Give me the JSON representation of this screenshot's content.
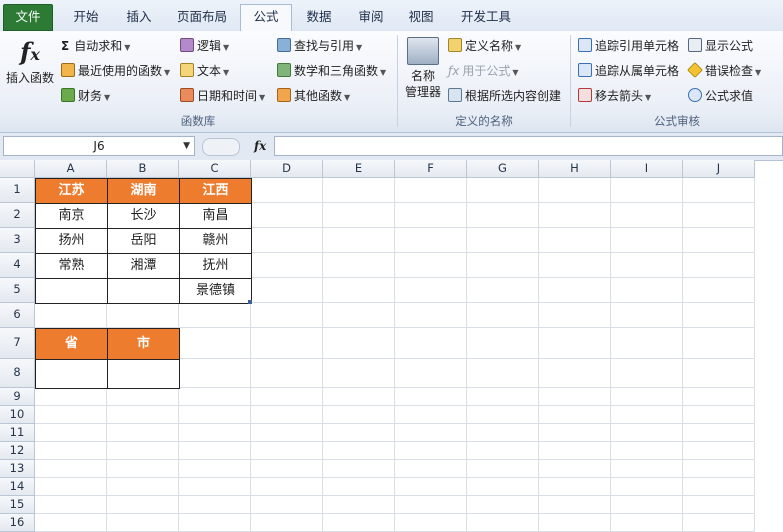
{
  "tabs": [
    "文件",
    "开始",
    "插入",
    "页面布局",
    "公式",
    "数据",
    "审阅",
    "视图",
    "开发工具"
  ],
  "ribbon": {
    "insert_function": "插入函数",
    "autosum": "自动求和",
    "recent": "最近使用的函数",
    "finance": "财务",
    "logic": "逻辑",
    "text": "文本",
    "datetime": "日期和时间",
    "lookup": "查找与引用",
    "math": "数学和三角函数",
    "other": "其他函数",
    "group_library": "函数库",
    "name_manager_1": "名称",
    "name_manager_2": "管理器",
    "define_name": "定义名称",
    "use_in_formula": "用于公式",
    "create_from_sel": "根据所选内容创建",
    "group_names": "定义的名称",
    "trace_precedents": "追踪引用单元格",
    "trace_dependents": "追踪从属单元格",
    "remove_arrows": "移去箭头",
    "show_formulas": "显示公式",
    "error_check": "错误检查",
    "evaluate": "公式求值",
    "group_audit": "公式审核"
  },
  "formula_bar": {
    "name_box": "J6",
    "fx": "fx",
    "formula": ""
  },
  "sheet": {
    "columns": [
      "A",
      "B",
      "C",
      "D",
      "E",
      "F",
      "G",
      "H",
      "I",
      "J"
    ],
    "rows": [
      "1",
      "2",
      "3",
      "4",
      "5",
      "6",
      "7",
      "8",
      "9",
      "10",
      "11",
      "12",
      "13",
      "14",
      "15",
      "16"
    ],
    "table1": {
      "headers": [
        "江苏",
        "湖南",
        "江西"
      ],
      "rows": [
        [
          "南京",
          "长沙",
          "南昌"
        ],
        [
          "扬州",
          "岳阳",
          "赣州"
        ],
        [
          "常熟",
          "湘潭",
          "抚州"
        ],
        [
          "",
          "",
          "景德镇"
        ]
      ]
    },
    "table2": {
      "headers": [
        "省",
        "市"
      ]
    }
  },
  "colors": {
    "header_fill": "#ee7c2f",
    "file_tab": "#2d7a35"
  }
}
